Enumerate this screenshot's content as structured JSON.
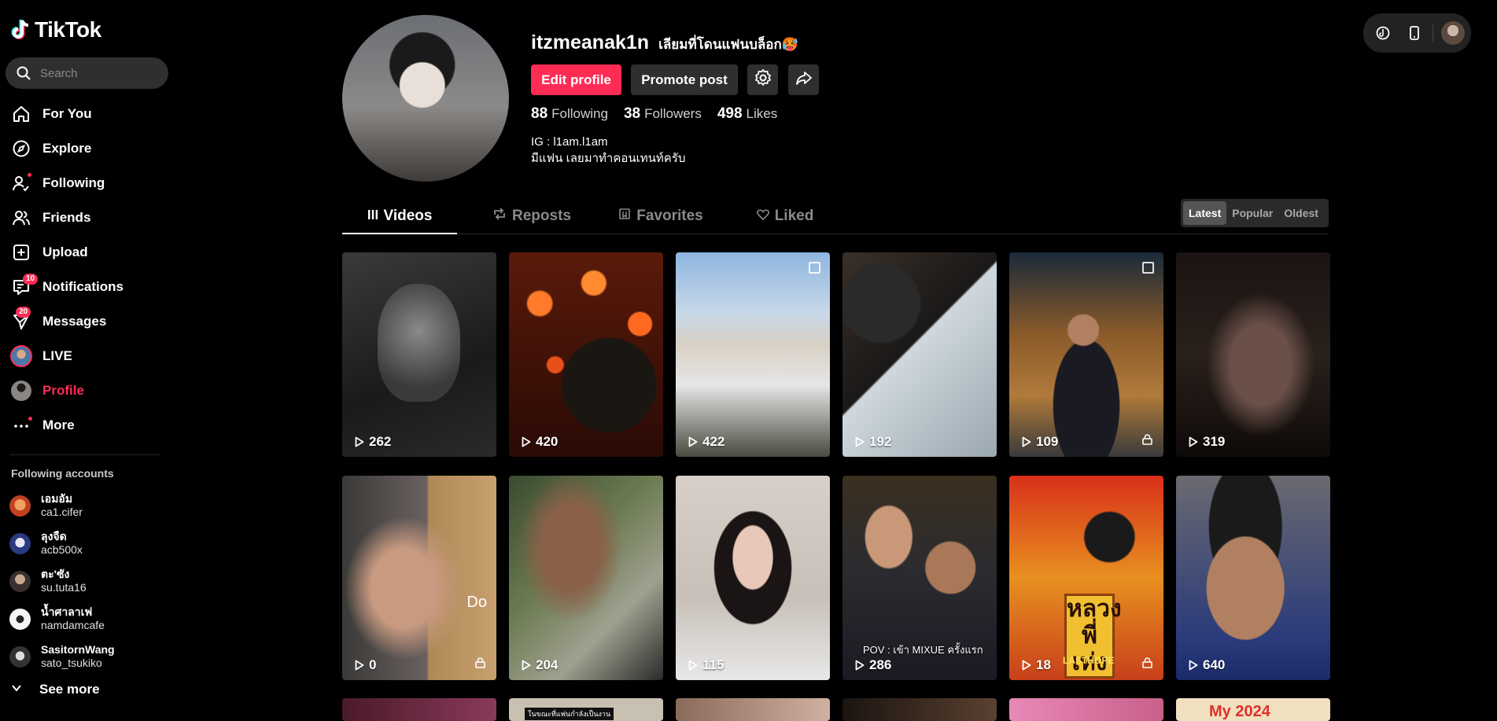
{
  "app": {
    "logo_text": "TikTok"
  },
  "search": {
    "placeholder": "Search"
  },
  "nav": [
    {
      "label": "For You",
      "icon": "home-icon"
    },
    {
      "label": "Explore",
      "icon": "compass-icon"
    },
    {
      "label": "Following",
      "icon": "following-icon"
    },
    {
      "label": "Friends",
      "icon": "friends-icon"
    },
    {
      "label": "Upload",
      "icon": "upload-icon"
    },
    {
      "label": "Notifications",
      "icon": "inbox-icon",
      "badge": "10"
    },
    {
      "label": "Messages",
      "icon": "messages-icon",
      "badge": "20"
    },
    {
      "label": "LIVE",
      "icon": "live-icon"
    },
    {
      "label": "Profile",
      "icon": "profile-avatar"
    },
    {
      "label": "More",
      "icon": "more-icon"
    }
  ],
  "following_accounts": {
    "title": "Following accounts",
    "items": [
      {
        "name": "เอมอัม",
        "username": "ca1.cifer"
      },
      {
        "name": "ลุงจืด",
        "username": "acb500x"
      },
      {
        "name": "ตะ'ซัง",
        "username": "su.tuta16"
      },
      {
        "name": "น้ำศาลาเฟ",
        "username": "namdamcafe"
      },
      {
        "name": "SasitornWang",
        "username": "sato_tsukiko"
      }
    ],
    "see_more": "See more"
  },
  "profile": {
    "username": "itzmeanak1n",
    "nickname": "เลียมที่โดนแฟนบล็อก🥵",
    "edit_button": "Edit profile",
    "promote_button": "Promote post",
    "stats": {
      "following": {
        "value": "88",
        "label": "Following"
      },
      "followers": {
        "value": "38",
        "label": "Followers"
      },
      "likes": {
        "value": "498",
        "label": "Likes"
      }
    },
    "bio_line1": "IG : l1am.l1am",
    "bio_line2": "มีแฟน เลยมาทำคอนเทนท์ครับ"
  },
  "tabs": {
    "videos": "Videos",
    "reposts": "Reposts",
    "favorites": "Favorites",
    "liked": "Liked"
  },
  "sort": {
    "latest": "Latest",
    "popular": "Popular",
    "oldest": "Oldest",
    "selected": "Latest"
  },
  "videos": [
    {
      "views": "262",
      "locked": false
    },
    {
      "views": "420",
      "locked": false
    },
    {
      "views": "422",
      "locked": false,
      "corner": true
    },
    {
      "views": "192",
      "locked": false
    },
    {
      "views": "109",
      "locked": true,
      "corner": true
    },
    {
      "views": "319",
      "locked": false
    },
    {
      "views": "0",
      "locked": true,
      "overlay": "Do"
    },
    {
      "views": "204",
      "locked": false
    },
    {
      "views": "115",
      "locked": false
    },
    {
      "views": "286",
      "locked": false,
      "caption": "POV : เข้า MIXUE ครั้งแรก"
    },
    {
      "views": "18",
      "locked": true,
      "poster": "หลวงพี่ เท่ง",
      "poster_sub": "LASTHOPE"
    },
    {
      "views": "640",
      "locked": false
    }
  ],
  "partial_row": {
    "caption_2": "ในขณะที่แฟนกำลังเป็นงาน",
    "caption_6": "My 2024"
  },
  "colors": {
    "accent": "#fe2c55",
    "background": "#000000",
    "surface": "#2f2f2f"
  }
}
